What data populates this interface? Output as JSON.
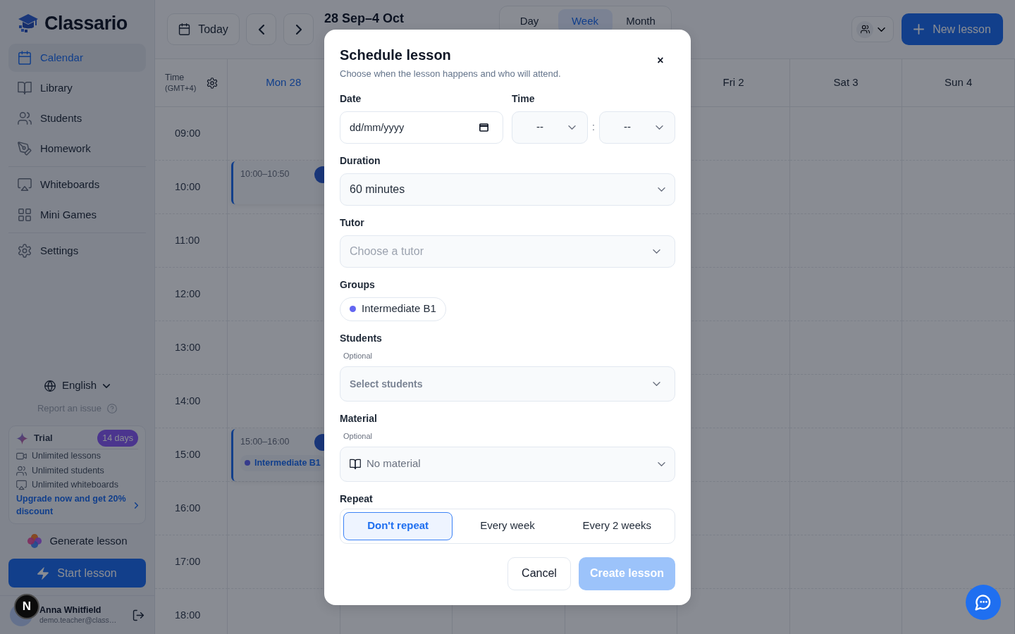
{
  "sidebar": {
    "brand": "Classario",
    "sections": [
      {
        "items": [
          {
            "label": "Calendar",
            "selected": true
          },
          {
            "label": "Library",
            "selected": false
          },
          {
            "label": "Students",
            "selected": false
          },
          {
            "label": "Homework",
            "selected": false
          }
        ]
      },
      {
        "items": [
          {
            "label": "Whiteboards",
            "selected": false
          },
          {
            "label": "Mini Games",
            "selected": false
          }
        ]
      },
      {
        "items": [
          {
            "label": "Settings",
            "selected": false
          }
        ]
      }
    ],
    "language": "English",
    "report_issue": "Report an issue",
    "trial": {
      "title": "Trial",
      "badge": "14 days",
      "features": [
        "Unlimited lessons",
        "Unlimited students",
        "Unlimited whiteboards"
      ],
      "upgrade_link": "Upgrade now and get 20% discount"
    },
    "generate_lesson": "Generate lesson",
    "start_lesson": "Start lesson",
    "user": {
      "name": "Anna Whitfield",
      "email": "demo.teacher@class…"
    }
  },
  "toolbar": {
    "today": "Today",
    "range": "28 Sep–4 Oct",
    "views": [
      {
        "label": "Day",
        "selected": false
      },
      {
        "label": "Week",
        "selected": true
      },
      {
        "label": "Month",
        "selected": false
      }
    ],
    "new_lesson": "New lesson"
  },
  "calendar": {
    "time_label": "Time",
    "timezone": "(GMT+4)",
    "days": [
      {
        "label": "Mon 28",
        "today": true,
        "events": [
          {
            "time": "10:00–10:50"
          },
          {
            "time": "15:00–16:00",
            "group": {
              "label": "Intermediate B1",
              "color": "#373b8c"
            }
          }
        ]
      },
      {
        "label": "Fri 2",
        "today": false
      },
      {
        "label": "Sat 3",
        "today": false
      },
      {
        "label": "Sun 4",
        "today": false
      }
    ],
    "hours": [
      "09:00",
      "10:00",
      "11:00",
      "12:00",
      "13:00",
      "14:00",
      "15:00",
      "16:00",
      "17:00",
      "18:00"
    ]
  },
  "dialog": {
    "title": "Schedule lesson",
    "subtitle": "Choose when the lesson happens and who will attend.",
    "close": "×",
    "date": {
      "label": "Date",
      "placeholder": "dd/mm/yyyy"
    },
    "time": {
      "label": "Time",
      "hour": "--",
      "minute": "--",
      "separator": ":"
    },
    "duration": {
      "label": "Duration",
      "value": "60 minutes"
    },
    "tutor": {
      "label": "Tutor",
      "placeholder": "Choose a tutor"
    },
    "groups": {
      "label": "Groups",
      "chips": [
        {
          "label": "Intermediate B1",
          "color": "#6366f1"
        }
      ]
    },
    "students": {
      "label": "Students",
      "hint": "Optional",
      "placeholder": "Select students"
    },
    "material": {
      "label": "Material",
      "hint": "Optional",
      "value": "No material"
    },
    "repeat": {
      "label": "Repeat",
      "options": [
        {
          "label": "Don't repeat",
          "selected": true
        },
        {
          "label": "Every week",
          "selected": false
        },
        {
          "label": "Every 2 weeks",
          "selected": false
        }
      ]
    },
    "cancel": "Cancel",
    "create": {
      "label": "Create lesson",
      "disabled": true
    }
  },
  "dev_badge": "N"
}
